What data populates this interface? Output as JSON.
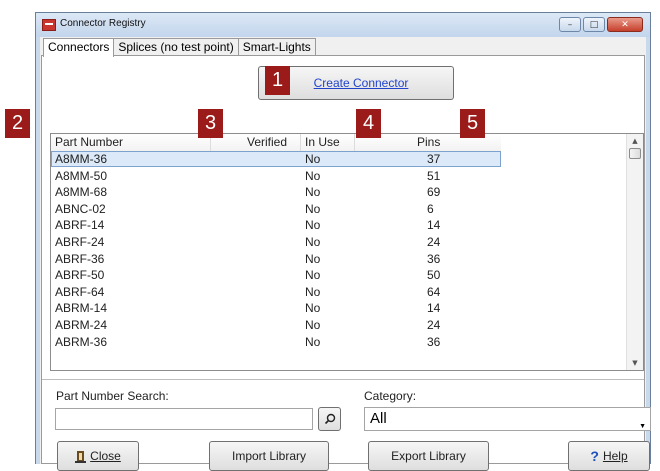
{
  "window": {
    "title": "Connector Registry",
    "accent": "#c9d9ec",
    "marker_color": "#9b1b1b"
  },
  "caption_buttons": {
    "minimize": "–",
    "maximize": "□",
    "close": "✕"
  },
  "tabs": [
    {
      "label": "Connectors",
      "active": true
    },
    {
      "label": "Splices (no test point)",
      "active": false
    },
    {
      "label": "Smart-Lights",
      "active": false
    }
  ],
  "create_button": {
    "label": "Create Connector"
  },
  "markers": [
    "1",
    "2",
    "3",
    "4",
    "5"
  ],
  "table": {
    "columns": [
      "Part Number",
      "Verified",
      "In Use",
      "Pins"
    ],
    "rows": [
      [
        "A8MM-36",
        "",
        "No",
        "37"
      ],
      [
        "A8MM-50",
        "",
        "No",
        "51"
      ],
      [
        "A8MM-68",
        "",
        "No",
        "69"
      ],
      [
        "ABNC-02",
        "",
        "No",
        "6"
      ],
      [
        "ABRF-14",
        "",
        "No",
        "14"
      ],
      [
        "ABRF-24",
        "",
        "No",
        "24"
      ],
      [
        "ABRF-36",
        "",
        "No",
        "36"
      ],
      [
        "ABRF-50",
        "",
        "No",
        "50"
      ],
      [
        "ABRF-64",
        "",
        "No",
        "64"
      ],
      [
        "ABRM-14",
        "",
        "No",
        "14"
      ],
      [
        "ABRM-24",
        "",
        "No",
        "24"
      ],
      [
        "ABRM-36",
        "",
        "No",
        "36"
      ]
    ],
    "selected_row": 0
  },
  "search": {
    "label": "Part Number Search:",
    "value": "",
    "button_icon": "search-icon"
  },
  "category": {
    "label": "Category:",
    "selected": "All"
  },
  "buttons": {
    "close": "Close",
    "import": "Import Library",
    "export": "Export Library",
    "help": "Help",
    "help_glyph": "?"
  }
}
